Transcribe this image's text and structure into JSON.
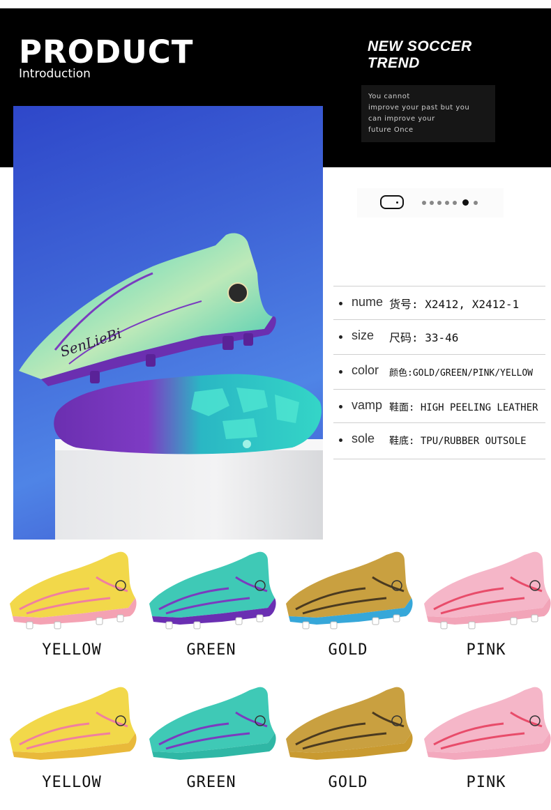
{
  "header": {
    "title": "PRODUCT",
    "subtitle": "Introduction",
    "trend_line1": "NEW SOCCER",
    "trend_line2": "TREND",
    "quote_lines": [
      "You cannot",
      "improve your past but you",
      "can improve your",
      "future Once"
    ]
  },
  "brand_on_shoe": "SenLieBi",
  "pager": {
    "dots_total": 7,
    "active_index": 5
  },
  "specs": [
    {
      "label": "nume",
      "value": "货号: X2412, X2412-1"
    },
    {
      "label": "size",
      "value": "尺码: 33-46"
    },
    {
      "label": "color",
      "value": "颜色:GOLD/GREEN/PINK/YELLOW"
    },
    {
      "label": "vamp",
      "value": "鞋面: HIGH PEELING LEATHER"
    },
    {
      "label": "sole",
      "value": "鞋底: TPU/RUBBER OUTSOLE"
    }
  ],
  "color_rows": [
    {
      "type": "firm-ground",
      "items": [
        {
          "name": "YELLOW",
          "upper": "#f2d84a",
          "accent": "#f07fa0",
          "sole": "#f4a2b3"
        },
        {
          "name": "GREEN",
          "upper": "#3fc9b6",
          "accent": "#7b3bbf",
          "sole": "#6a2fb2"
        },
        {
          "name": "GOLD",
          "upper": "#c9a040",
          "accent": "#4a3a20",
          "sole": "#36a7d9"
        },
        {
          "name": "PINK",
          "upper": "#f5b6c8",
          "accent": "#e84c6a",
          "sole": "#f2a4b8"
        }
      ]
    },
    {
      "type": "turf",
      "items": [
        {
          "name": "YELLOW",
          "upper": "#f2d84a",
          "accent": "#f07fa0",
          "sole": "#e9b93a"
        },
        {
          "name": "GREEN",
          "upper": "#3fc9b6",
          "accent": "#7b3bbf",
          "sole": "#2fb7a5"
        },
        {
          "name": "GOLD",
          "upper": "#c9a040",
          "accent": "#4a3a20",
          "sole": "#c99a30"
        },
        {
          "name": "PINK",
          "upper": "#f5b6c8",
          "accent": "#e84c6a",
          "sole": "#f3a8bd"
        }
      ]
    }
  ],
  "colors": {
    "header_bg": "#000000",
    "hero_bg": "#3e63d6",
    "hero_shoe_upper": "#3fd2be",
    "hero_shoe_sole": "#6b2fb0"
  }
}
